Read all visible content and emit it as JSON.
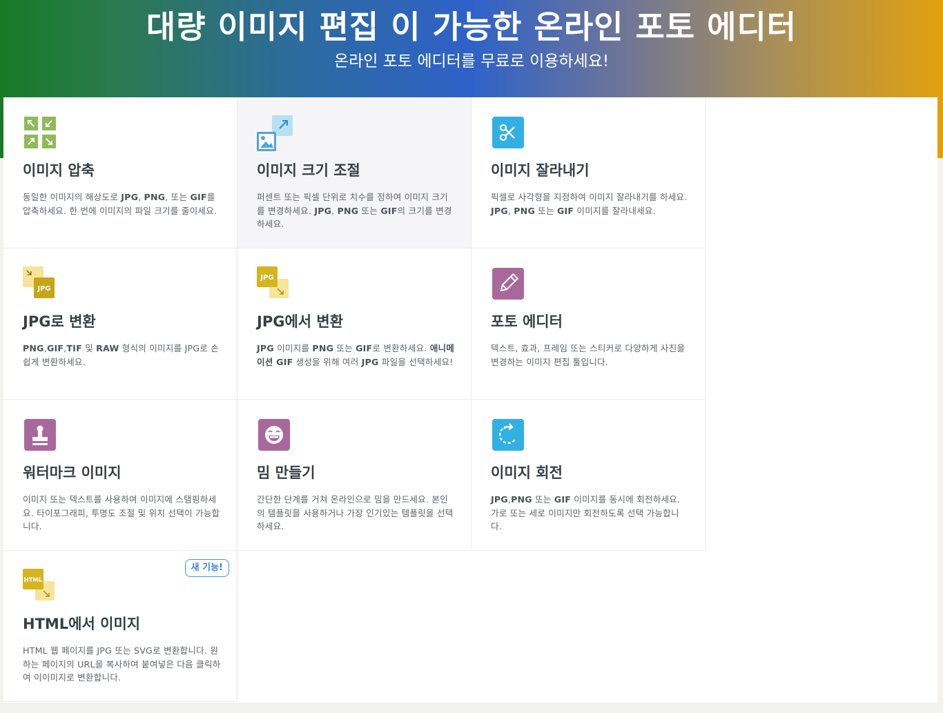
{
  "hero": {
    "title": "대량 이미지 편집 이 가능한 온라인 포토 에디터",
    "subtitle": "온라인 포토 에디터를 무료로 이용하세요!"
  },
  "tools": [
    {
      "id": "compress",
      "title": "이미지 압축",
      "icon": "compress-icon",
      "color": "#8ebb5a",
      "desc_parts": [
        {
          "t": "동일한 이미지의 해상도로 "
        },
        {
          "t": "JPG",
          "b": true
        },
        {
          "t": ", "
        },
        {
          "t": "PNG",
          "b": true
        },
        {
          "t": ", 또는 "
        },
        {
          "t": "GIF",
          "b": true
        },
        {
          "t": "를 압축하세요. 한 번에 이미지의 파일 크기를 줄이세요."
        }
      ]
    },
    {
      "id": "resize",
      "title": "이미지 크기 조절",
      "icon": "resize-icon",
      "color": "#4fa6dc",
      "highlighted": true,
      "desc_parts": [
        {
          "t": "퍼센트 또는 픽셀 단위로 치수를 정하여 이미지 크기를 변경하세요. "
        },
        {
          "t": "JPG",
          "b": true
        },
        {
          "t": ", "
        },
        {
          "t": "PNG",
          "b": true
        },
        {
          "t": " 또는 "
        },
        {
          "t": "GIF",
          "b": true
        },
        {
          "t": "의 크기를 변경하세요."
        }
      ]
    },
    {
      "id": "crop",
      "title": "이미지 잘라내기",
      "icon": "scissors-icon",
      "color": "#33b0e3",
      "desc_parts": [
        {
          "t": "픽셀로 사각형을 지정하여 이미지 잘라내기를 하세요. "
        },
        {
          "t": "JPG",
          "b": true
        },
        {
          "t": ", "
        },
        {
          "t": "PNG",
          "b": true
        },
        {
          "t": " 또는 "
        },
        {
          "t": "GIF",
          "b": true
        },
        {
          "t": " 이미지를 잘라내세요."
        }
      ]
    },
    {
      "id": "to-jpg",
      "title": "JPG로 변환",
      "icon": "convert-to-jpg-icon",
      "icon_label": "JPG",
      "color": "#c6a517",
      "desc_parts": [
        {
          "t": "PNG",
          "b": true
        },
        {
          "t": ","
        },
        {
          "t": "GIF",
          "b": true
        },
        {
          "t": ","
        },
        {
          "t": "TIF",
          "b": true
        },
        {
          "t": " 및 "
        },
        {
          "t": "RAW",
          "b": true
        },
        {
          "t": " 형식의 이미지를 JPG로 손쉽게 변환하세요."
        }
      ]
    },
    {
      "id": "from-jpg",
      "title": "JPG에서 변환",
      "icon": "convert-from-jpg-icon",
      "icon_label": "JPG",
      "color": "#d4b51f",
      "desc_parts": [
        {
          "t": "JPG",
          "b": true
        },
        {
          "t": " 이미지를 "
        },
        {
          "t": "PNG",
          "b": true
        },
        {
          "t": " 또는 "
        },
        {
          "t": "GIF",
          "b": true
        },
        {
          "t": "로 변환하세요. "
        },
        {
          "t": "애니메이션 GIF",
          "b": true
        },
        {
          "t": " 생성을 위해 여러 "
        },
        {
          "t": "JPG",
          "b": true
        },
        {
          "t": " 파일을 선택하세요!"
        }
      ]
    },
    {
      "id": "editor",
      "title": "포토 에디터",
      "icon": "pencil-icon",
      "color": "#a9689b",
      "desc_parts": [
        {
          "t": "텍스트, 효과, 프레임 또는 스티커로 다양하게 사진을 변경하는 이미지 편집 툴입니다."
        }
      ]
    },
    {
      "id": "watermark",
      "title": "워터마크 이미지",
      "icon": "stamp-icon",
      "color": "#a9689b",
      "desc_parts": [
        {
          "t": "이미지 또는 텍스트를 사용하여 이미지에 스탬핑하세요. 타이포그래피, 투명도 조절 및 위치 선택이 가능합니다."
        }
      ]
    },
    {
      "id": "meme",
      "title": "밈 만들기",
      "icon": "laugh-face-icon",
      "color": "#a9689b",
      "desc_parts": [
        {
          "t": "간단한 단계를 거쳐 온라인으로 밈을 만드세요. 본인의 템플릿을 사용하거나 가장 인기있는 템플릿을 선택하세요."
        }
      ]
    },
    {
      "id": "rotate",
      "title": "이미지 회전",
      "icon": "rotate-icon",
      "color": "#33b0e3",
      "desc_parts": [
        {
          "t": "JPG",
          "b": true
        },
        {
          "t": ","
        },
        {
          "t": "PNG",
          "b": true
        },
        {
          "t": " 또는 "
        },
        {
          "t": "GIF",
          "b": true
        },
        {
          "t": " 이미지를 동시에 회전하세요. 가로 또는 세로 이미지만 회전하도록 선택 가능합니다."
        }
      ]
    },
    {
      "id": "html-to-image",
      "title": "HTML에서 이미지",
      "icon": "html-convert-icon",
      "icon_label": "HTML",
      "color": "#d4b51f",
      "badge": "새 기능!",
      "desc_parts": [
        {
          "t": "HTML 웹 페이지를 JPG 또는 SVG로 변환합니다. 원하는 페이지의 URL을 복사하여 붙여넣은 다음 클릭하여 이이미지로 변환합니다."
        }
      ]
    }
  ]
}
